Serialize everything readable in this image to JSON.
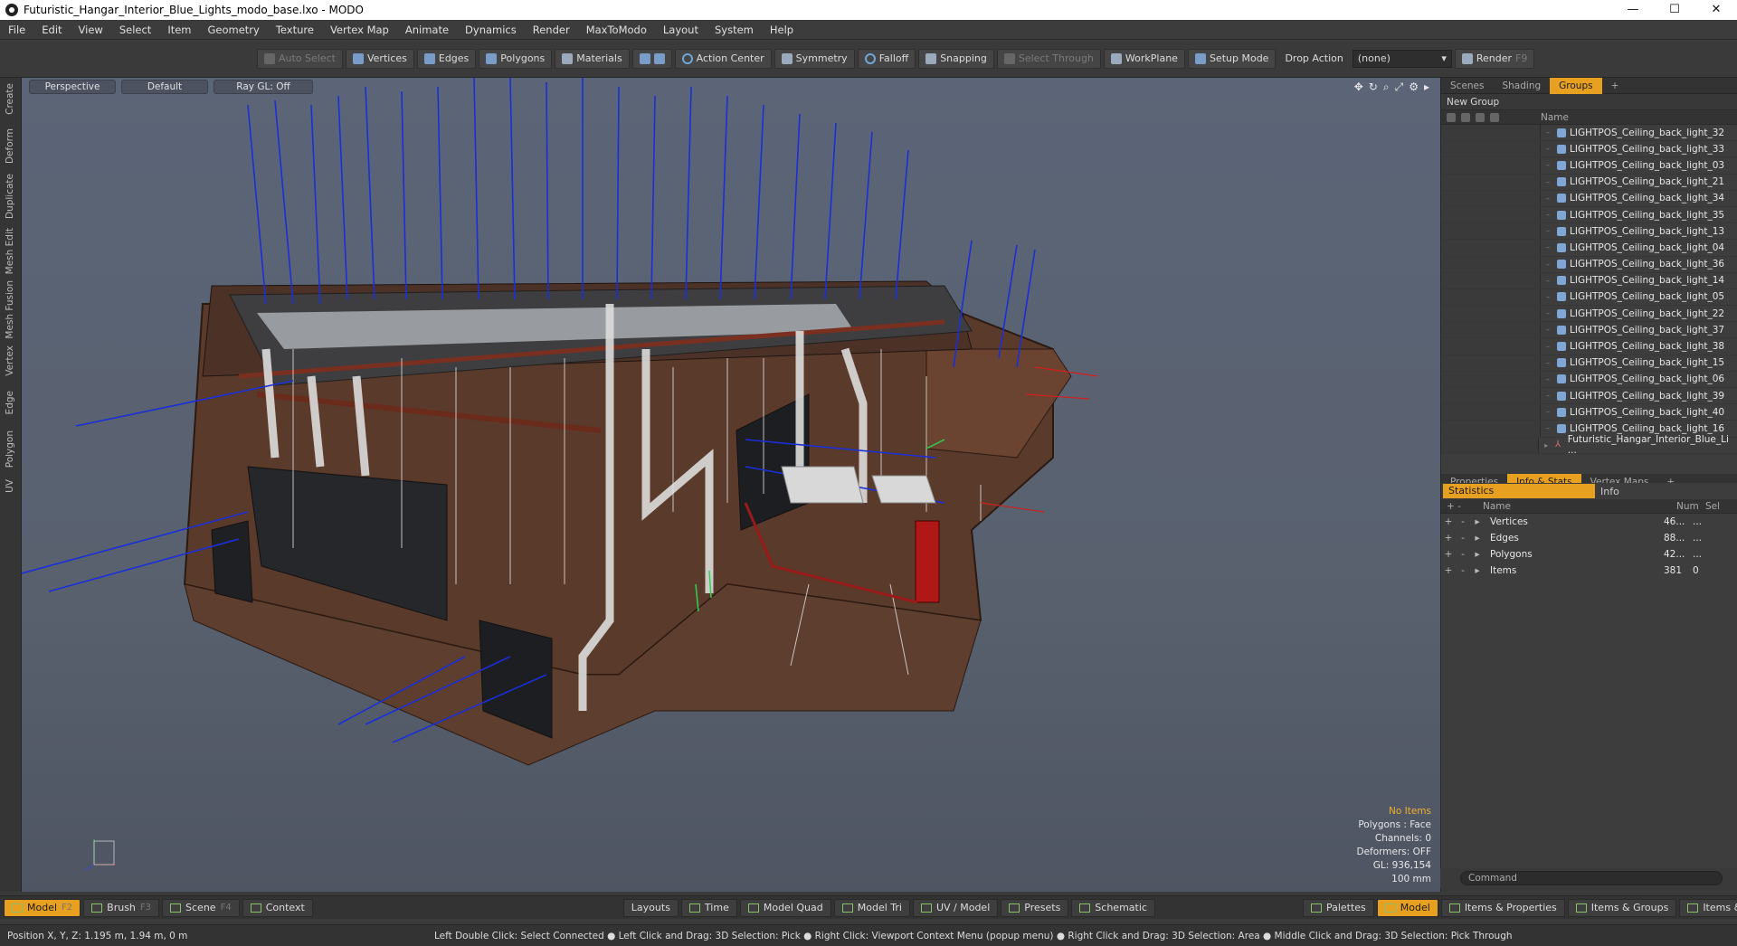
{
  "window": {
    "title": "Futuristic_Hangar_Interior_Blue_Lights_modo_base.lxo - MODO"
  },
  "menu": [
    "File",
    "Edit",
    "View",
    "Select",
    "Item",
    "Geometry",
    "Texture",
    "Vertex Map",
    "Animate",
    "Dynamics",
    "Render",
    "MaxToModo",
    "Layout",
    "System",
    "Help"
  ],
  "toolbar": {
    "auto_select": "Auto Select",
    "vertices": "Vertices",
    "edges": "Edges",
    "polygons": "Polygons",
    "materials": "Materials",
    "action_center": "Action Center",
    "symmetry": "Symmetry",
    "falloff": "Falloff",
    "snapping": "Snapping",
    "select_through": "Select Through",
    "workplane": "WorkPlane",
    "setup_mode": "Setup Mode",
    "drop_action": "Drop Action",
    "drop_value": "(none)",
    "render": "Render",
    "render_key": "F9"
  },
  "left_tabs": [
    "Create",
    "Deform",
    "Duplicate",
    "Mesh Edit",
    "Mesh Fusion",
    "Vertex",
    "Edge",
    "Polygon",
    "UV"
  ],
  "viewport": {
    "view": "Perspective",
    "shading": "Default",
    "raygl": "Ray GL: Off",
    "hud": {
      "items": "No Items",
      "polygons": "Polygons : Face",
      "channels": "Channels: 0",
      "deformers": "Deformers: OFF",
      "gl": "GL: 936,154",
      "unit": "100 mm"
    }
  },
  "scene_tabs": {
    "scenes": "Scenes",
    "shading": "Shading",
    "groups": "Groups"
  },
  "groups": {
    "new_group": "New Group",
    "col_name": "Name",
    "items": [
      "LIGHTPOS_Ceiling_back_light_32",
      "LIGHTPOS_Ceiling_back_light_33",
      "LIGHTPOS_Ceiling_back_light_03",
      "LIGHTPOS_Ceiling_back_light_21",
      "LIGHTPOS_Ceiling_back_light_34",
      "LIGHTPOS_Ceiling_back_light_35",
      "LIGHTPOS_Ceiling_back_light_13",
      "LIGHTPOS_Ceiling_back_light_04",
      "LIGHTPOS_Ceiling_back_light_36",
      "LIGHTPOS_Ceiling_back_light_14",
      "LIGHTPOS_Ceiling_back_light_05",
      "LIGHTPOS_Ceiling_back_light_22",
      "LIGHTPOS_Ceiling_back_light_37",
      "LIGHTPOS_Ceiling_back_light_38",
      "LIGHTPOS_Ceiling_back_light_15",
      "LIGHTPOS_Ceiling_back_light_06",
      "LIGHTPOS_Ceiling_back_light_39",
      "LIGHTPOS_Ceiling_back_light_40",
      "LIGHTPOS_Ceiling_back_light_16"
    ],
    "mesh_item": "Futuristic_Hangar_Interior_Blue_Li ..."
  },
  "prop_tabs": {
    "properties": "Properties",
    "info_stats": "Info & Stats",
    "vertex_maps": "Vertex Maps"
  },
  "stats": {
    "tab_statistics": "Statistics",
    "tab_info": "Info",
    "col_name": "Name",
    "col_num": "Num",
    "col_sel": "Sel",
    "rows": [
      {
        "name": "Vertices",
        "num": "46...",
        "sel": "..."
      },
      {
        "name": "Edges",
        "num": "88...",
        "sel": "..."
      },
      {
        "name": "Polygons",
        "num": "42...",
        "sel": "..."
      },
      {
        "name": "Items",
        "num": "381",
        "sel": "0"
      }
    ]
  },
  "command": {
    "placeholder": "Command"
  },
  "bottom": {
    "model": "Model",
    "model_key": "F2",
    "brush": "Brush",
    "brush_key": "F3",
    "scene": "Scene",
    "scene_key": "F4",
    "context": "Context",
    "layouts": "Layouts",
    "time": "Time",
    "model_quad": "Model Quad",
    "model_tri": "Model Tri",
    "uv_model": "UV / Model",
    "presets": "Presets",
    "schematic": "Schematic",
    "palettes": "Palettes",
    "model2": "Model",
    "items_props": "Items & Properties",
    "items_groups": "Items & Groups",
    "items_shading": "Items & Shadin"
  },
  "status": {
    "position": "Position X, Y, Z:   1.195 m, 1.94 m, 0 m",
    "hints": "Left Double Click: Select Connected ● Left Click and Drag: 3D Selection: Pick ● Right Click: Viewport Context Menu (popup menu) ● Right Click and Drag: 3D Selection: Area ● Middle Click and Drag: 3D Selection: Pick Through"
  }
}
